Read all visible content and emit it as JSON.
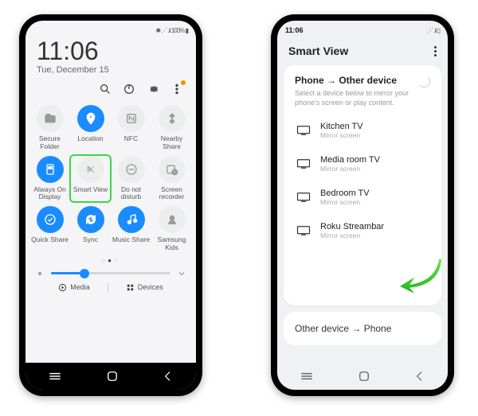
{
  "left": {
    "status": {
      "time": "",
      "right": "✱ ⋰ .ıl 100% ▮"
    },
    "clock": "11:06",
    "date": "Tue, December 15",
    "iconbar": [
      "search",
      "power",
      "gear",
      "more"
    ],
    "tiles": [
      {
        "id": "secure-folder",
        "label": "Secure\nFolder",
        "on": false,
        "icon": "folder"
      },
      {
        "id": "location",
        "label": "Location",
        "on": true,
        "icon": "pin"
      },
      {
        "id": "nfc",
        "label": "NFC",
        "on": false,
        "icon": "nfc"
      },
      {
        "id": "nearby-share",
        "label": "Nearby\nShare",
        "on": false,
        "icon": "nearby"
      },
      {
        "id": "aod",
        "label": "Always On\nDisplay",
        "on": true,
        "icon": "aod"
      },
      {
        "id": "smart-view",
        "label": "Smart View",
        "on": false,
        "icon": "cast",
        "highlight": true
      },
      {
        "id": "dnd",
        "label": "Do not\ndisturb",
        "on": false,
        "icon": "dnd"
      },
      {
        "id": "screen-rec",
        "label": "Screen\nrecorder",
        "on": false,
        "icon": "rec"
      },
      {
        "id": "quick-share",
        "label": "Quick Share",
        "on": true,
        "icon": "qshare"
      },
      {
        "id": "sync",
        "label": "Sync",
        "on": true,
        "icon": "sync"
      },
      {
        "id": "music-share",
        "label": "Music Share",
        "on": true,
        "icon": "music"
      },
      {
        "id": "samsung-kids",
        "label": "Samsung\nKids",
        "on": false,
        "icon": "kids"
      }
    ],
    "brightness_pct": 28,
    "media_label": "Media",
    "devices_label": "Devices"
  },
  "right": {
    "status": {
      "time": "11:06",
      "right": "⋰ .ıl ▯"
    },
    "header": "Smart View",
    "card_title": "Phone → Other device",
    "card_sub": "Select a device below to mirror your phone's screen or play content.",
    "devices": [
      {
        "name": "Kitchen TV",
        "sub": "Mirror screen"
      },
      {
        "name": "Media room TV",
        "sub": "Mirror screen"
      },
      {
        "name": "Bedroom TV",
        "sub": "Mirror screen"
      },
      {
        "name": "Roku Streambar",
        "sub": "Mirror screen",
        "arrow": true
      }
    ],
    "bottom_card": "Other device → Phone"
  }
}
